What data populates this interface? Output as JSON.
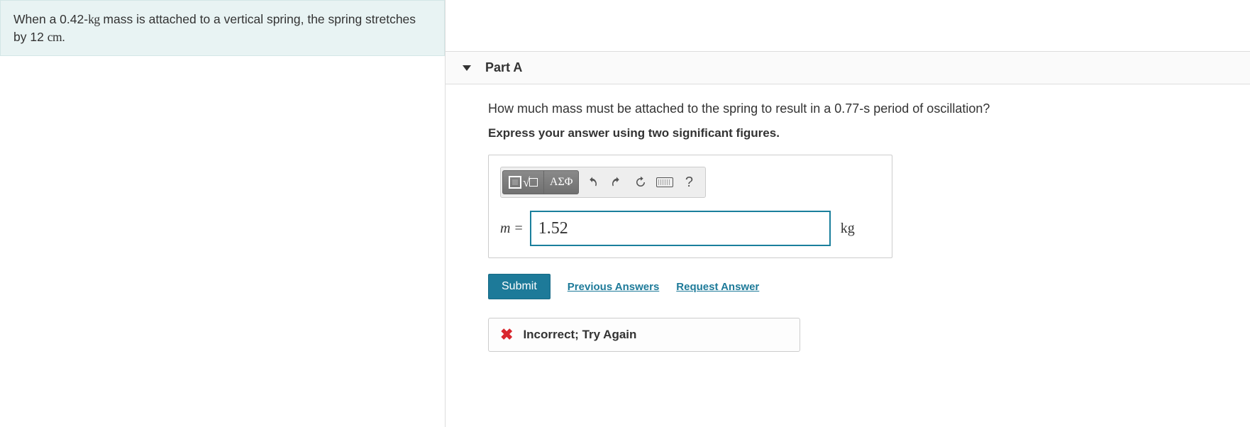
{
  "problem": {
    "text_prefix": "When a 0.42-",
    "unit_kg": "kg",
    "text_mid": " mass is attached to a vertical spring, the spring stretches by 12 ",
    "unit_cm": "cm",
    "text_suffix": "."
  },
  "part": {
    "label": "Part A",
    "question": "How much mass must be attached to the spring to result in a 0.77-s period of oscillation?",
    "instruction": "Express your answer using two significant figures."
  },
  "toolbar": {
    "templates_label": "x√□",
    "greek_label": "ΑΣΦ",
    "undo_icon": "undo-icon",
    "redo_icon": "redo-icon",
    "reset_icon": "reset-icon",
    "keyboard_icon": "keyboard-icon",
    "help_label": "?"
  },
  "answer": {
    "variable": "m",
    "equals": "=",
    "value": "1.52",
    "unit": "kg"
  },
  "actions": {
    "submit": "Submit",
    "previous": "Previous Answers",
    "request": "Request Answer"
  },
  "feedback": {
    "text": "Incorrect; Try Again"
  }
}
